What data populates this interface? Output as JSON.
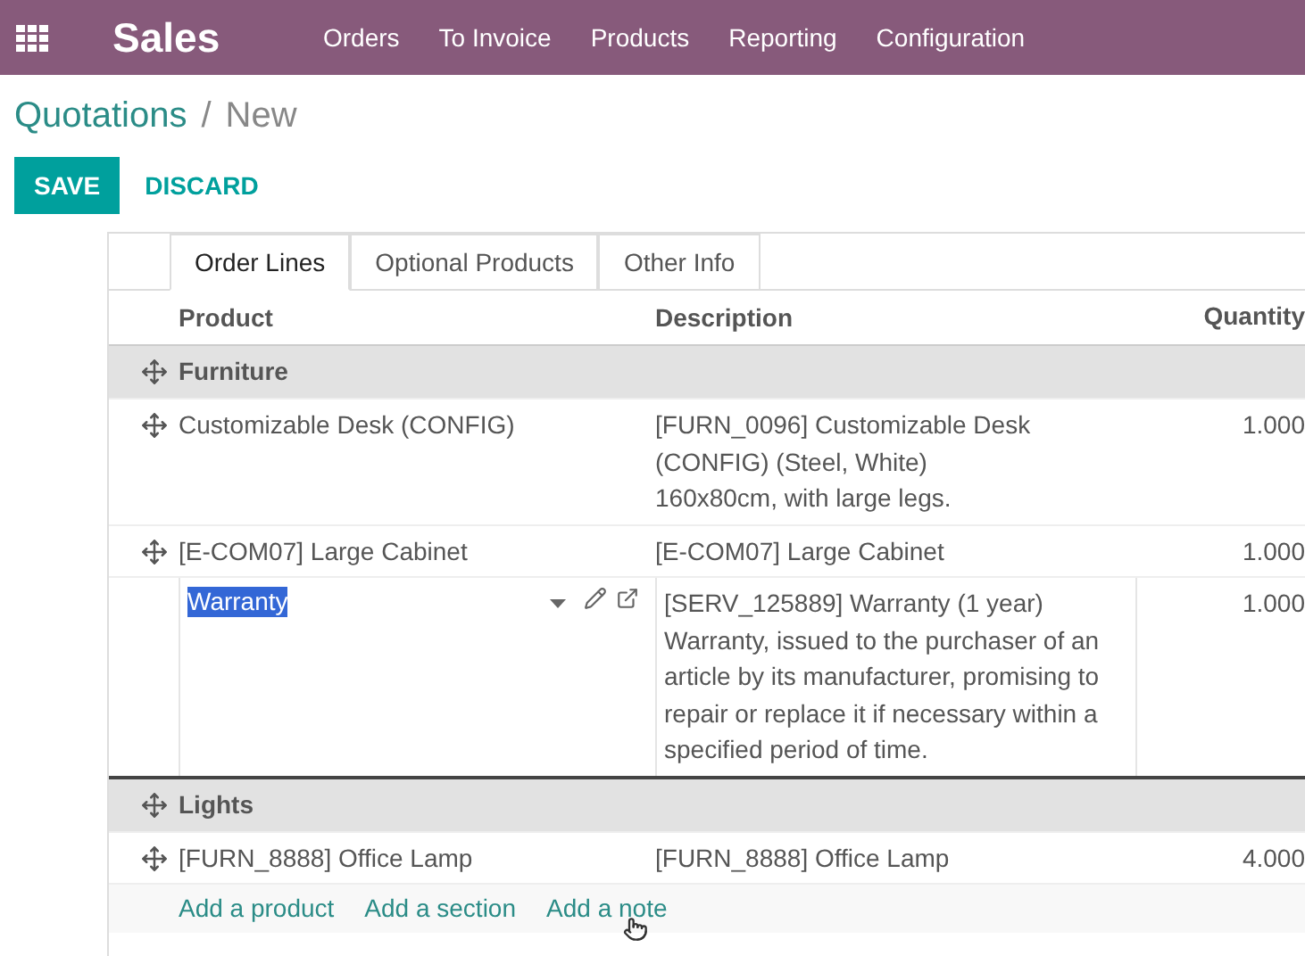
{
  "app": {
    "title": "Sales",
    "menu": [
      "Orders",
      "To Invoice",
      "Products",
      "Reporting",
      "Configuration"
    ]
  },
  "breadcrumb": {
    "parent": "Quotations",
    "separator": "/",
    "current": "New"
  },
  "buttons": {
    "save": "SAVE",
    "discard": "DISCARD"
  },
  "tabs": [
    {
      "label": "Order Lines",
      "selected": true
    },
    {
      "label": "Optional Products",
      "selected": false
    },
    {
      "label": "Other Info",
      "selected": false
    }
  ],
  "columns": [
    "Product",
    "Description",
    "Quantity"
  ],
  "rows": [
    {
      "kind": "section",
      "name": "Furniture"
    },
    {
      "kind": "product",
      "product": "Customizable Desk (CONFIG)",
      "description": [
        "[FURN_0096] Customizable Desk",
        "(CONFIG) (Steel, White)",
        "160x80cm, with large legs."
      ],
      "quantity": "1.000"
    },
    {
      "kind": "product",
      "product": "[E-COM07] Large Cabinet",
      "description": [
        "[E-COM07] Large Cabinet"
      ],
      "quantity": "1.000"
    },
    {
      "kind": "editing",
      "product": "Warranty",
      "description": [
        "[SERV_125889] Warranty (1 year)",
        "Warranty, issued to the purchaser of an",
        "article by its manufacturer, promising to",
        "repair or replace it if necessary within a",
        "specified period of time."
      ],
      "quantity": "1.000"
    },
    {
      "kind": "section",
      "name": "Lights"
    },
    {
      "kind": "product",
      "product": "[FURN_8888] Office Lamp",
      "description": [
        "[FURN_8888] Office Lamp"
      ],
      "quantity": "4.000"
    }
  ],
  "add_links": [
    "Add a product",
    "Add a section",
    "Add a note"
  ]
}
